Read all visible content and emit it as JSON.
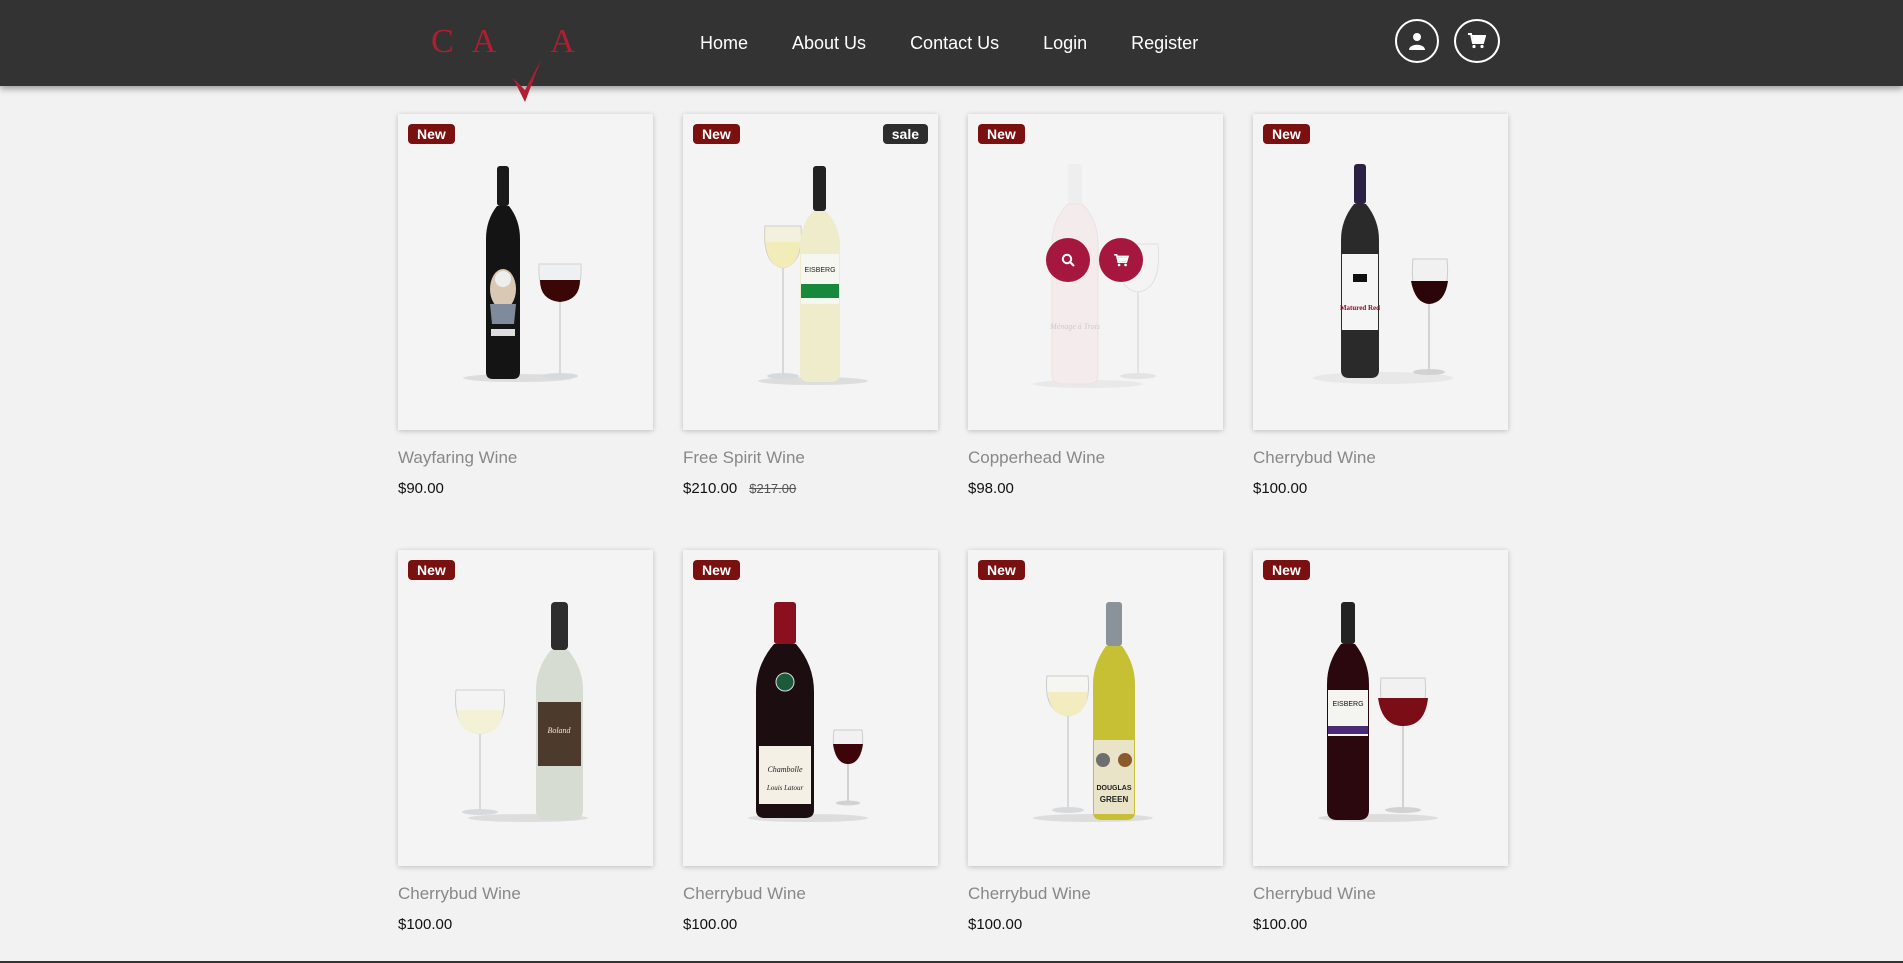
{
  "brand": {
    "logo_text_1": "C",
    "logo_text_2": "A",
    "logo_text_3": "A",
    "accent_color": "#b01e33"
  },
  "nav": {
    "items": [
      {
        "label": "Home"
      },
      {
        "label": "About Us"
      },
      {
        "label": "Contact Us"
      },
      {
        "label": "Login"
      },
      {
        "label": "Register"
      }
    ]
  },
  "header_icons": {
    "account": "user-icon",
    "cart": "cart-icon"
  },
  "products": [
    {
      "name": "Wayfaring Wine",
      "price": "$90.00",
      "old_price": "",
      "badge": "New",
      "sale": "",
      "bottle": "black-art",
      "glass": "red"
    },
    {
      "name": "Free Spirit Wine",
      "price": "$210.00",
      "old_price": "$217.00",
      "badge": "New",
      "sale": "sale",
      "bottle": "white-green",
      "glass": "white"
    },
    {
      "name": "Copperhead Wine",
      "price": "$98.00",
      "old_price": "",
      "badge": "New",
      "sale": "",
      "bottle": "rose",
      "glass": "empty"
    },
    {
      "name": "Cherrybud Wine",
      "price": "$100.00",
      "old_price": "",
      "badge": "New",
      "sale": "",
      "bottle": "red-label",
      "glass": "red"
    },
    {
      "name": "Cherrybud Wine",
      "price": "$100.00",
      "old_price": "",
      "badge": "New",
      "sale": "",
      "bottle": "white-frost",
      "glass": "white"
    },
    {
      "name": "Cherrybud Wine",
      "price": "$100.00",
      "old_price": "",
      "badge": "New",
      "sale": "",
      "bottle": "burgundy",
      "glass": "red"
    },
    {
      "name": "Cherrybud Wine",
      "price": "$100.00",
      "old_price": "",
      "badge": "New",
      "sale": "",
      "bottle": "yellow",
      "glass": "white"
    },
    {
      "name": "Cherrybud Wine",
      "price": "$100.00",
      "old_price": "",
      "badge": "New",
      "sale": "",
      "bottle": "dark-red",
      "glass": "red"
    }
  ],
  "hover_actions": {
    "quick_view": "search-icon",
    "add_to_cart": "cart-icon"
  }
}
